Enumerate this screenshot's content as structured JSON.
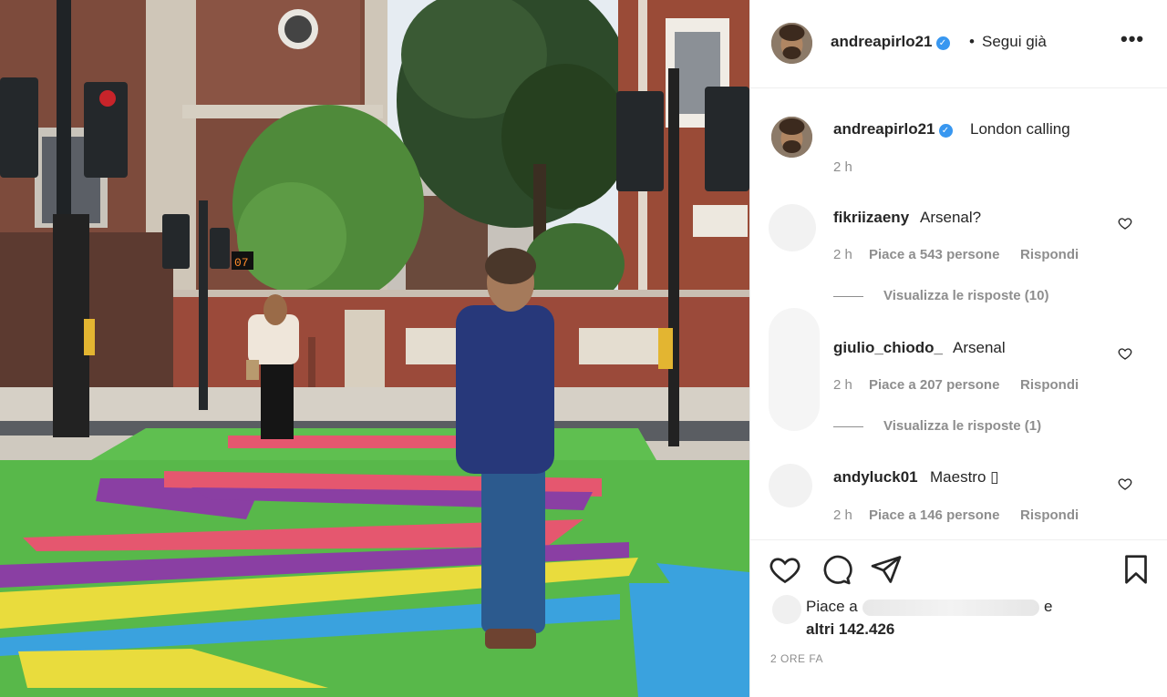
{
  "post": {
    "username": "andreapirlo21",
    "separator": "•",
    "follow_status": "Segui già",
    "more": "•••",
    "caption_text": "London calling",
    "caption_time": "2 h",
    "likes_prefix": "Piace a",
    "likes_suffix": "e",
    "likes_others": "altri 142.426",
    "timestamp": "2 ORE FA"
  },
  "photo": {
    "traffic_counter": "07"
  },
  "comments": [
    {
      "username": "fikriizaeny",
      "text": "Arsenal?",
      "time": "2 h",
      "likes": "Piace a 543 persone",
      "reply": "Rispondi",
      "view_replies": "Visualizza le risposte (10)"
    },
    {
      "username": "giulio_chiodo_",
      "text": "Arsenal",
      "time": "2 h",
      "likes": "Piace a 207 persone",
      "reply": "Rispondi",
      "view_replies": "Visualizza le risposte (1)"
    },
    {
      "username": "andyluck01",
      "text": "Maestro ▯",
      "time": "2 h",
      "likes": "Piace a 146 persone",
      "reply": "Rispondi"
    }
  ],
  "icons": {
    "verified": "verified-badge-icon",
    "like": "heart-icon",
    "comment": "comment-bubble-icon",
    "share": "paper-plane-icon",
    "save": "bookmark-icon",
    "more": "more-options-icon"
  },
  "colors": {
    "accent_blue": "#3897f0",
    "text": "#262626",
    "secondary": "#8e8e8e",
    "divider": "#efefef"
  }
}
